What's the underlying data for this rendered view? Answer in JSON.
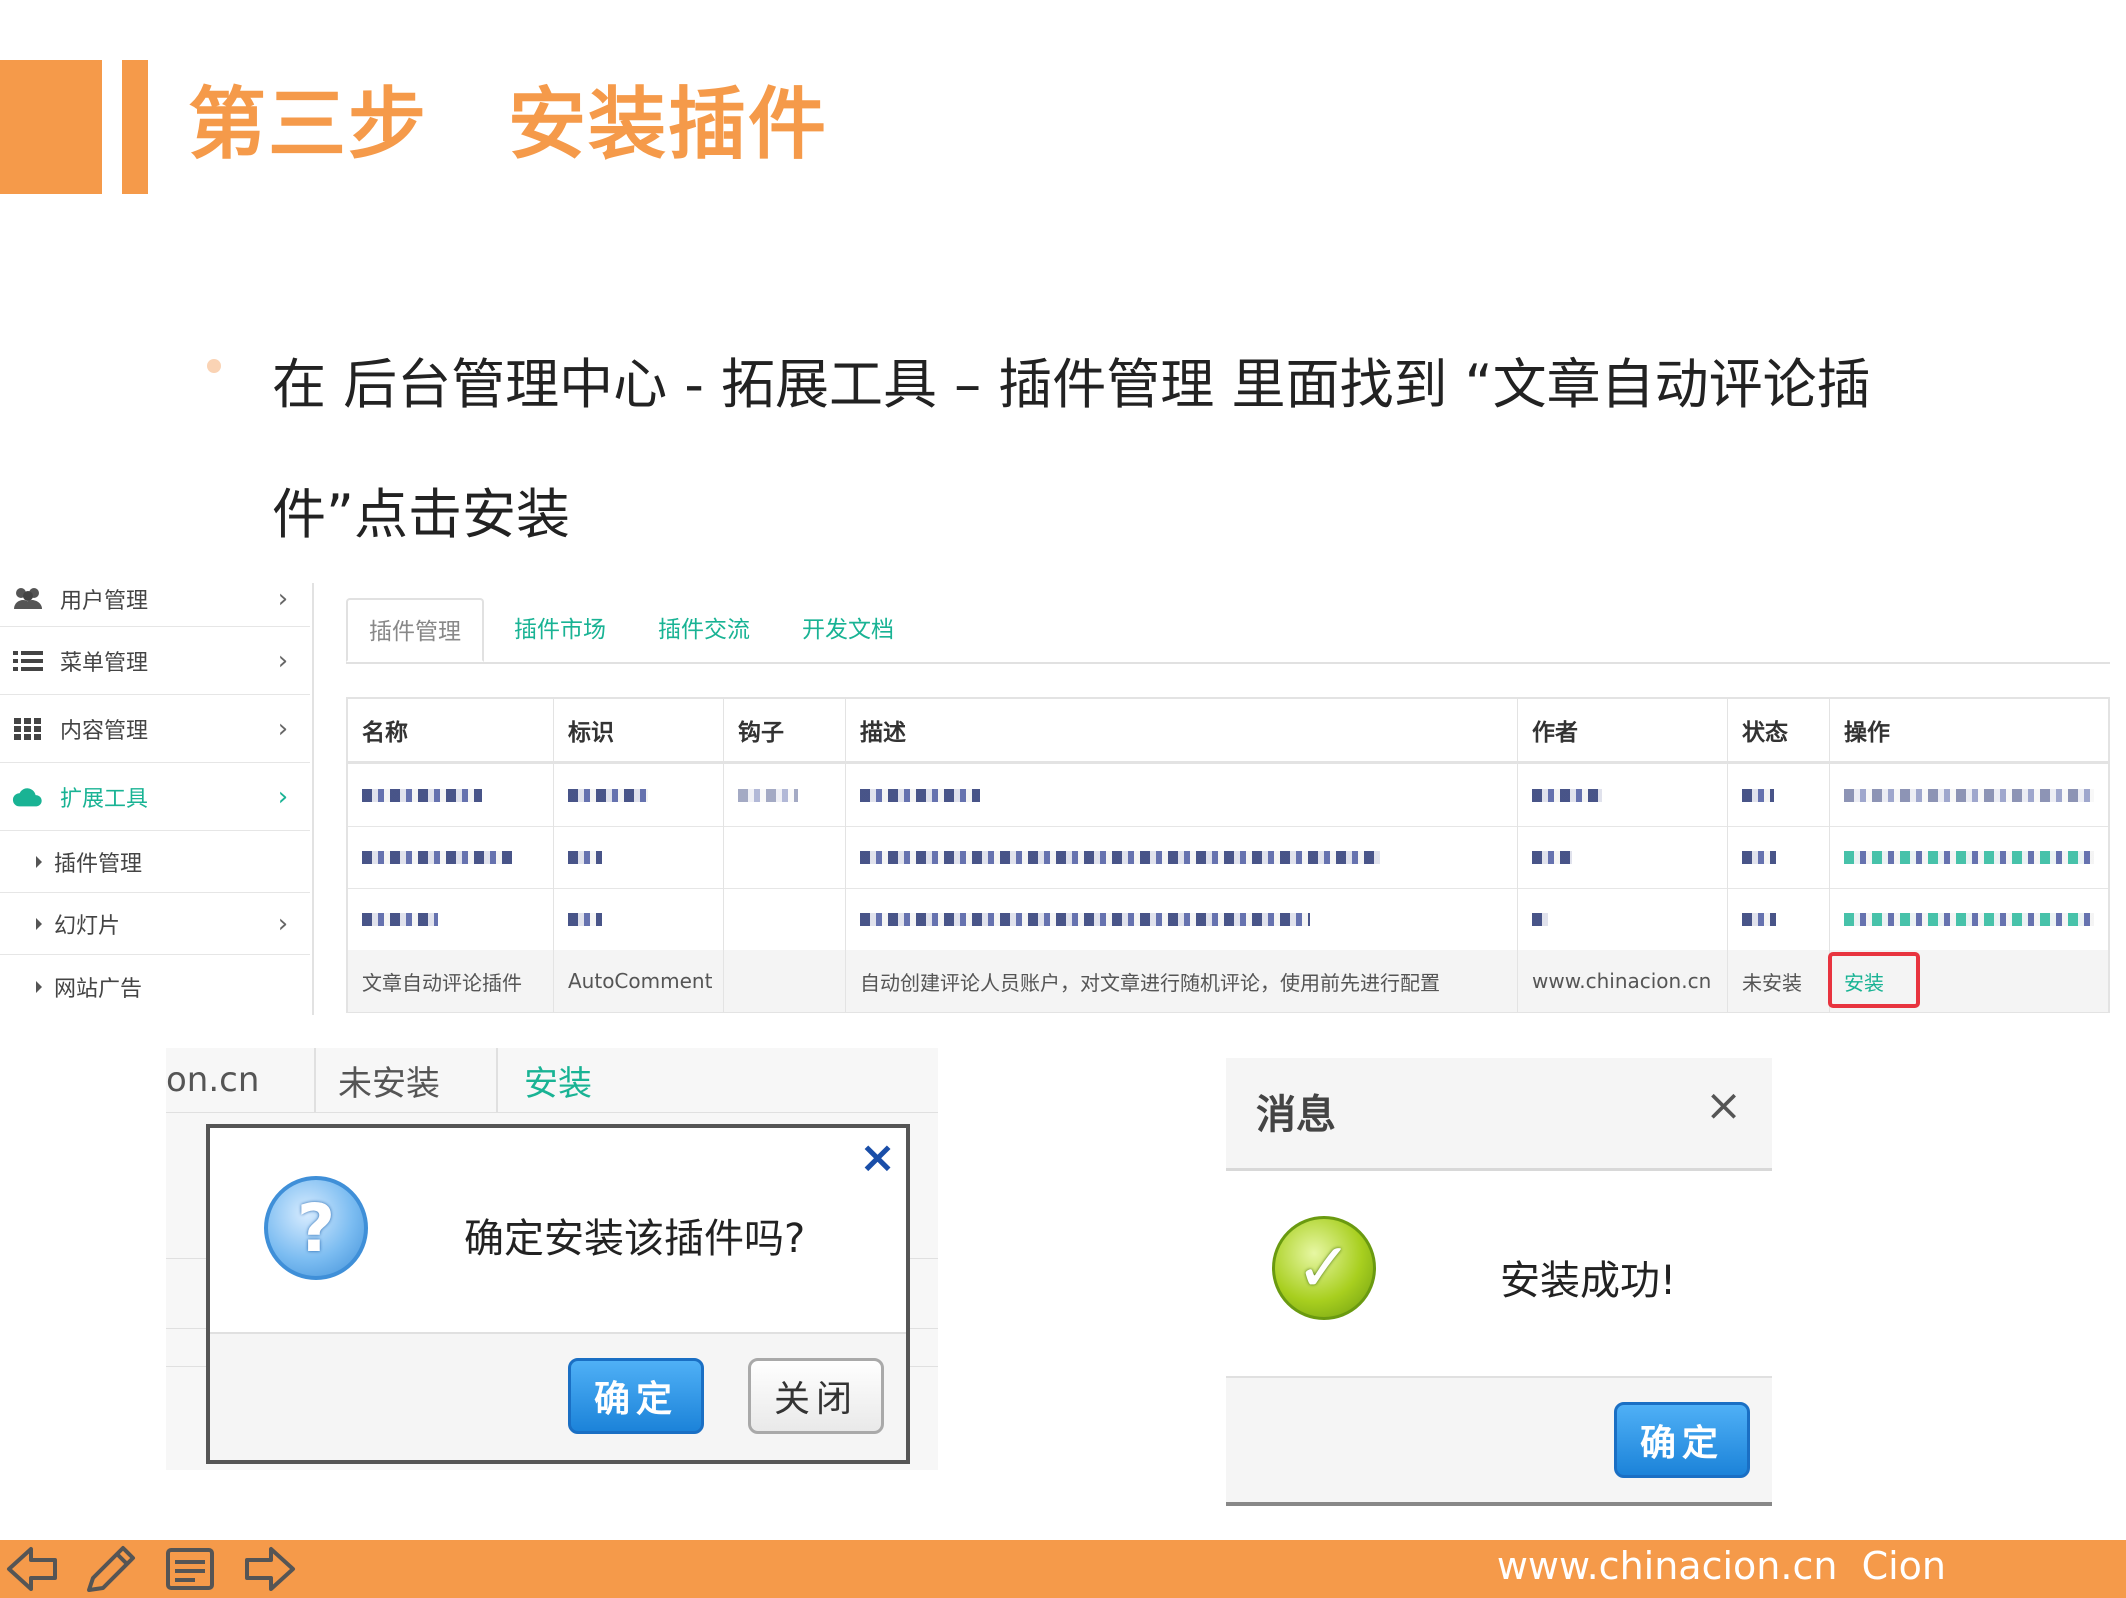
{
  "slide": {
    "title": "第三步　安装插件",
    "instruction": "在 后台管理中心 - 拓展工具 – 插件管理 里面找到 “文章自动评论插件”点击安装"
  },
  "sidebar": {
    "items": [
      {
        "label": "用户管理",
        "icon": "users-icon"
      },
      {
        "label": "菜单管理",
        "icon": "list-icon"
      },
      {
        "label": "内容管理",
        "icon": "grid-icon"
      },
      {
        "label": "扩展工具",
        "icon": "cloud-icon"
      },
      {
        "label": "插件管理"
      },
      {
        "label": "幻灯片"
      },
      {
        "label": "网站广告"
      }
    ]
  },
  "tabs": [
    "插件管理",
    "插件市场",
    "插件交流",
    "开发文档"
  ],
  "table": {
    "headers": [
      "名称",
      "标识",
      "钩子",
      "描述",
      "作者",
      "状态",
      "操作"
    ],
    "row": {
      "name": "文章自动评论插件",
      "id": "AutoComment",
      "hook": "",
      "description": "自动创建评论人员账户，对文章进行随机评论，使用前先进行配置",
      "author": "www.chinacion.cn",
      "status": "未安装",
      "action": "安装"
    }
  },
  "confirm_dialog": {
    "snippet": {
      "author_tail": "on.cn",
      "status": "未安装",
      "action": "安装"
    },
    "close_glyph": "×",
    "message": "确定安装该插件吗?",
    "ok_label": "确定",
    "close_label": "关闭"
  },
  "success_dialog": {
    "title": "消息",
    "close_glyph": "×",
    "message": "安装成功!",
    "ok_label": "确定"
  },
  "footer": {
    "site": "www.chinacion.cn  Cion"
  },
  "colors": {
    "accent_orange": "#F59A4A",
    "link_green": "#19B394",
    "highlight_red": "#E8343F",
    "button_blue": "#1C83D9"
  }
}
